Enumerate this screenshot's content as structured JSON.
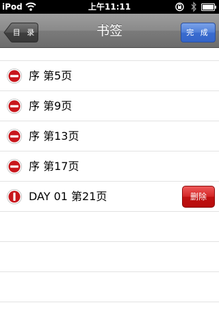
{
  "status_bar": {
    "carrier": "iPod",
    "time": "上午11:11"
  },
  "nav": {
    "back_label": "目 录",
    "title": "书签",
    "done_label": "完 成"
  },
  "bookmarks": [
    {
      "label": "序 第5页",
      "icon": "delete-minus-icon"
    },
    {
      "label": "序 第9页",
      "icon": "delete-minus-icon"
    },
    {
      "label": "序 第13页",
      "icon": "delete-minus-icon"
    },
    {
      "label": "序 第17页",
      "icon": "delete-minus-icon"
    },
    {
      "label": "DAY 01 第21页",
      "icon": "delete-confirm-icon",
      "delete_label": "删除"
    }
  ],
  "colors": {
    "delete_red": "#c0161b",
    "done_blue": "#3f73d3",
    "nav_gray": "#8a8a8a"
  }
}
